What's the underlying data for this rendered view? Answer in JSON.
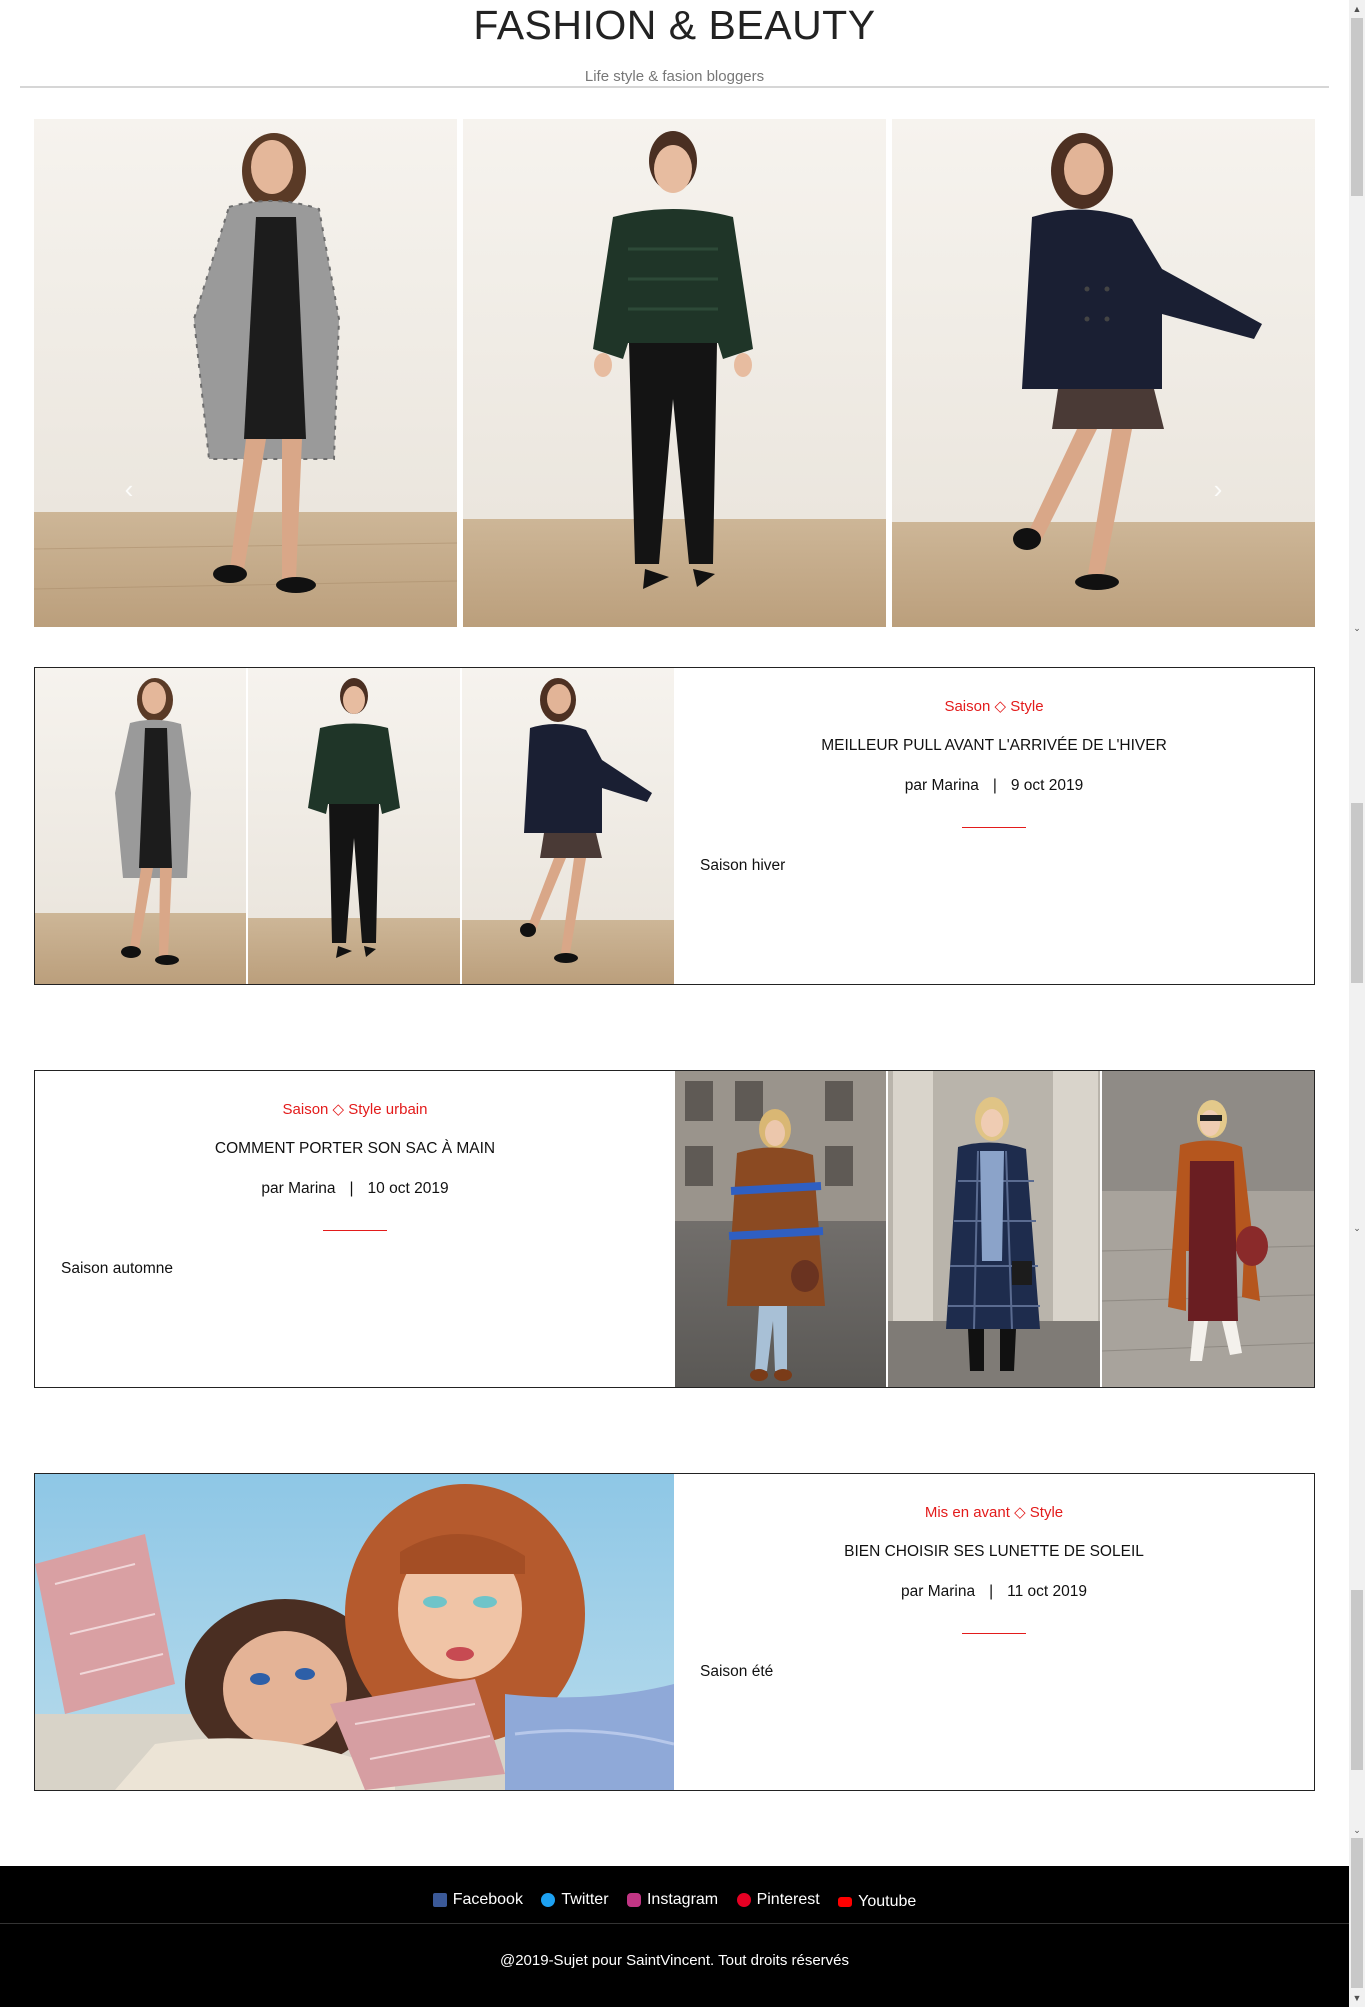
{
  "header": {
    "title": "FASHION & BEAUTY",
    "tagline": "Life style & fasion bloggers"
  },
  "carousel": {
    "prev_icon": "chevron-left-icon",
    "next_icon": "chevron-right-icon",
    "prev_glyph": "‹",
    "next_glyph": "›",
    "slide_count": 4,
    "active_slide": 1
  },
  "articles": [
    {
      "category": "Saison ◇ Style",
      "title": "MEILLEUR PULL AVANT L'ARRIVÉE DE L'HIVER",
      "author": "par Marina",
      "separator": "|",
      "date": "9 oct 2019",
      "excerpt": "Saison hiver"
    },
    {
      "category": "Saison ◇ Style urbain",
      "title": "COMMENT PORTER SON SAC À MAIN",
      "author": "par Marina",
      "separator": "|",
      "date": "10 oct 2019",
      "excerpt": "Saison automne"
    },
    {
      "category": "Mis en avant ◇ Style",
      "title": "BIEN CHOISIR SES LUNETTE DE SOLEIL",
      "author": "par Marina",
      "separator": "|",
      "date": "11 oct 2019",
      "excerpt": "Saison été"
    }
  ],
  "footer": {
    "social": [
      {
        "label": "Facebook",
        "icon": "facebook-icon",
        "color": "#3b5998"
      },
      {
        "label": "Twitter",
        "icon": "twitter-icon",
        "color": "#1da1f2"
      },
      {
        "label": "Instagram",
        "icon": "instagram-icon",
        "color": "#c13584"
      },
      {
        "label": "Pinterest",
        "icon": "pinterest-icon",
        "color": "#e60023"
      },
      {
        "label": "Youtube",
        "icon": "youtube-icon",
        "color": "#ff0000"
      }
    ],
    "copyright": "@2019-Sujet pour SaintVincent. Tout droits réservés"
  },
  "colors": {
    "accent_red": "#e31b1b",
    "footer_bg": "#000000",
    "card_border": "#222222"
  }
}
